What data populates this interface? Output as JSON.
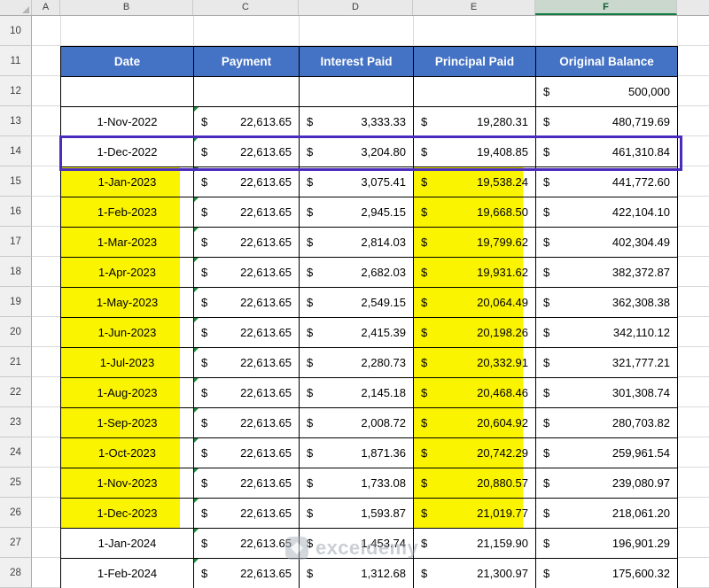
{
  "app": {
    "name": "Excel spreadsheet view"
  },
  "colors": {
    "table_header_fill": "#4472C4",
    "table_header_text": "#FFFFFF",
    "highlight_yellow": "#FBF400",
    "selection_border_purple": "#4A2BBE",
    "selected_column_header_fill": "#CBD8CE",
    "selected_column_accent_green": "#107C41",
    "error_indicator_green": "#1E8A3C",
    "gridline": "#DADADA",
    "cell_border": "#000000"
  },
  "column_headers": [
    "A",
    "B",
    "C",
    "D",
    "E",
    "F"
  ],
  "selected_column": "F",
  "row_headers": [
    "10",
    "11",
    "12",
    "13",
    "14",
    "15",
    "16",
    "17",
    "18",
    "19",
    "20",
    "21",
    "22",
    "23",
    "24",
    "25",
    "26",
    "27",
    "28"
  ],
  "table": {
    "currency": "$",
    "headers": [
      "Date",
      "Payment",
      "Interest Paid",
      "Principal Paid",
      "Original Balance"
    ],
    "initial_balance": "500,000",
    "selected_row_date": "1-Dec-2022",
    "rows": [
      {
        "date": "1-Nov-2022",
        "payment": "22,613.65",
        "interest": "3,333.33",
        "principal": "19,280.31",
        "balance": "480,719.69",
        "highlighted": false
      },
      {
        "date": "1-Dec-2022",
        "payment": "22,613.65",
        "interest": "3,204.80",
        "principal": "19,408.85",
        "balance": "461,310.84",
        "highlighted": false,
        "selected": true
      },
      {
        "date": "1-Jan-2023",
        "payment": "22,613.65",
        "interest": "3,075.41",
        "principal": "19,538.24",
        "balance": "441,772.60",
        "highlighted": true
      },
      {
        "date": "1-Feb-2023",
        "payment": "22,613.65",
        "interest": "2,945.15",
        "principal": "19,668.50",
        "balance": "422,104.10",
        "highlighted": true
      },
      {
        "date": "1-Mar-2023",
        "payment": "22,613.65",
        "interest": "2,814.03",
        "principal": "19,799.62",
        "balance": "402,304.49",
        "highlighted": true
      },
      {
        "date": "1-Apr-2023",
        "payment": "22,613.65",
        "interest": "2,682.03",
        "principal": "19,931.62",
        "balance": "382,372.87",
        "highlighted": true
      },
      {
        "date": "1-May-2023",
        "payment": "22,613.65",
        "interest": "2,549.15",
        "principal": "20,064.49",
        "balance": "362,308.38",
        "highlighted": true
      },
      {
        "date": "1-Jun-2023",
        "payment": "22,613.65",
        "interest": "2,415.39",
        "principal": "20,198.26",
        "balance": "342,110.12",
        "highlighted": true
      },
      {
        "date": "1-Jul-2023",
        "payment": "22,613.65",
        "interest": "2,280.73",
        "principal": "20,332.91",
        "balance": "321,777.21",
        "highlighted": true
      },
      {
        "date": "1-Aug-2023",
        "payment": "22,613.65",
        "interest": "2,145.18",
        "principal": "20,468.46",
        "balance": "301,308.74",
        "highlighted": true
      },
      {
        "date": "1-Sep-2023",
        "payment": "22,613.65",
        "interest": "2,008.72",
        "principal": "20,604.92",
        "balance": "280,703.82",
        "highlighted": true
      },
      {
        "date": "1-Oct-2023",
        "payment": "22,613.65",
        "interest": "1,871.36",
        "principal": "20,742.29",
        "balance": "259,961.54",
        "highlighted": true
      },
      {
        "date": "1-Nov-2023",
        "payment": "22,613.65",
        "interest": "1,733.08",
        "principal": "20,880.57",
        "balance": "239,080.97",
        "highlighted": true
      },
      {
        "date": "1-Dec-2023",
        "payment": "22,613.65",
        "interest": "1,593.87",
        "principal": "21,019.77",
        "balance": "218,061.20",
        "highlighted": true
      },
      {
        "date": "1-Jan-2024",
        "payment": "22,613.65",
        "interest": "1,453.74",
        "principal": "21,159.90",
        "balance": "196,901.29",
        "highlighted": false
      },
      {
        "date": "1-Feb-2024",
        "payment": "22,613.65",
        "interest": "1,312.68",
        "principal": "21,300.97",
        "balance": "175,600.32",
        "highlighted": false
      }
    ]
  },
  "watermark": {
    "text": "exceldemy"
  }
}
